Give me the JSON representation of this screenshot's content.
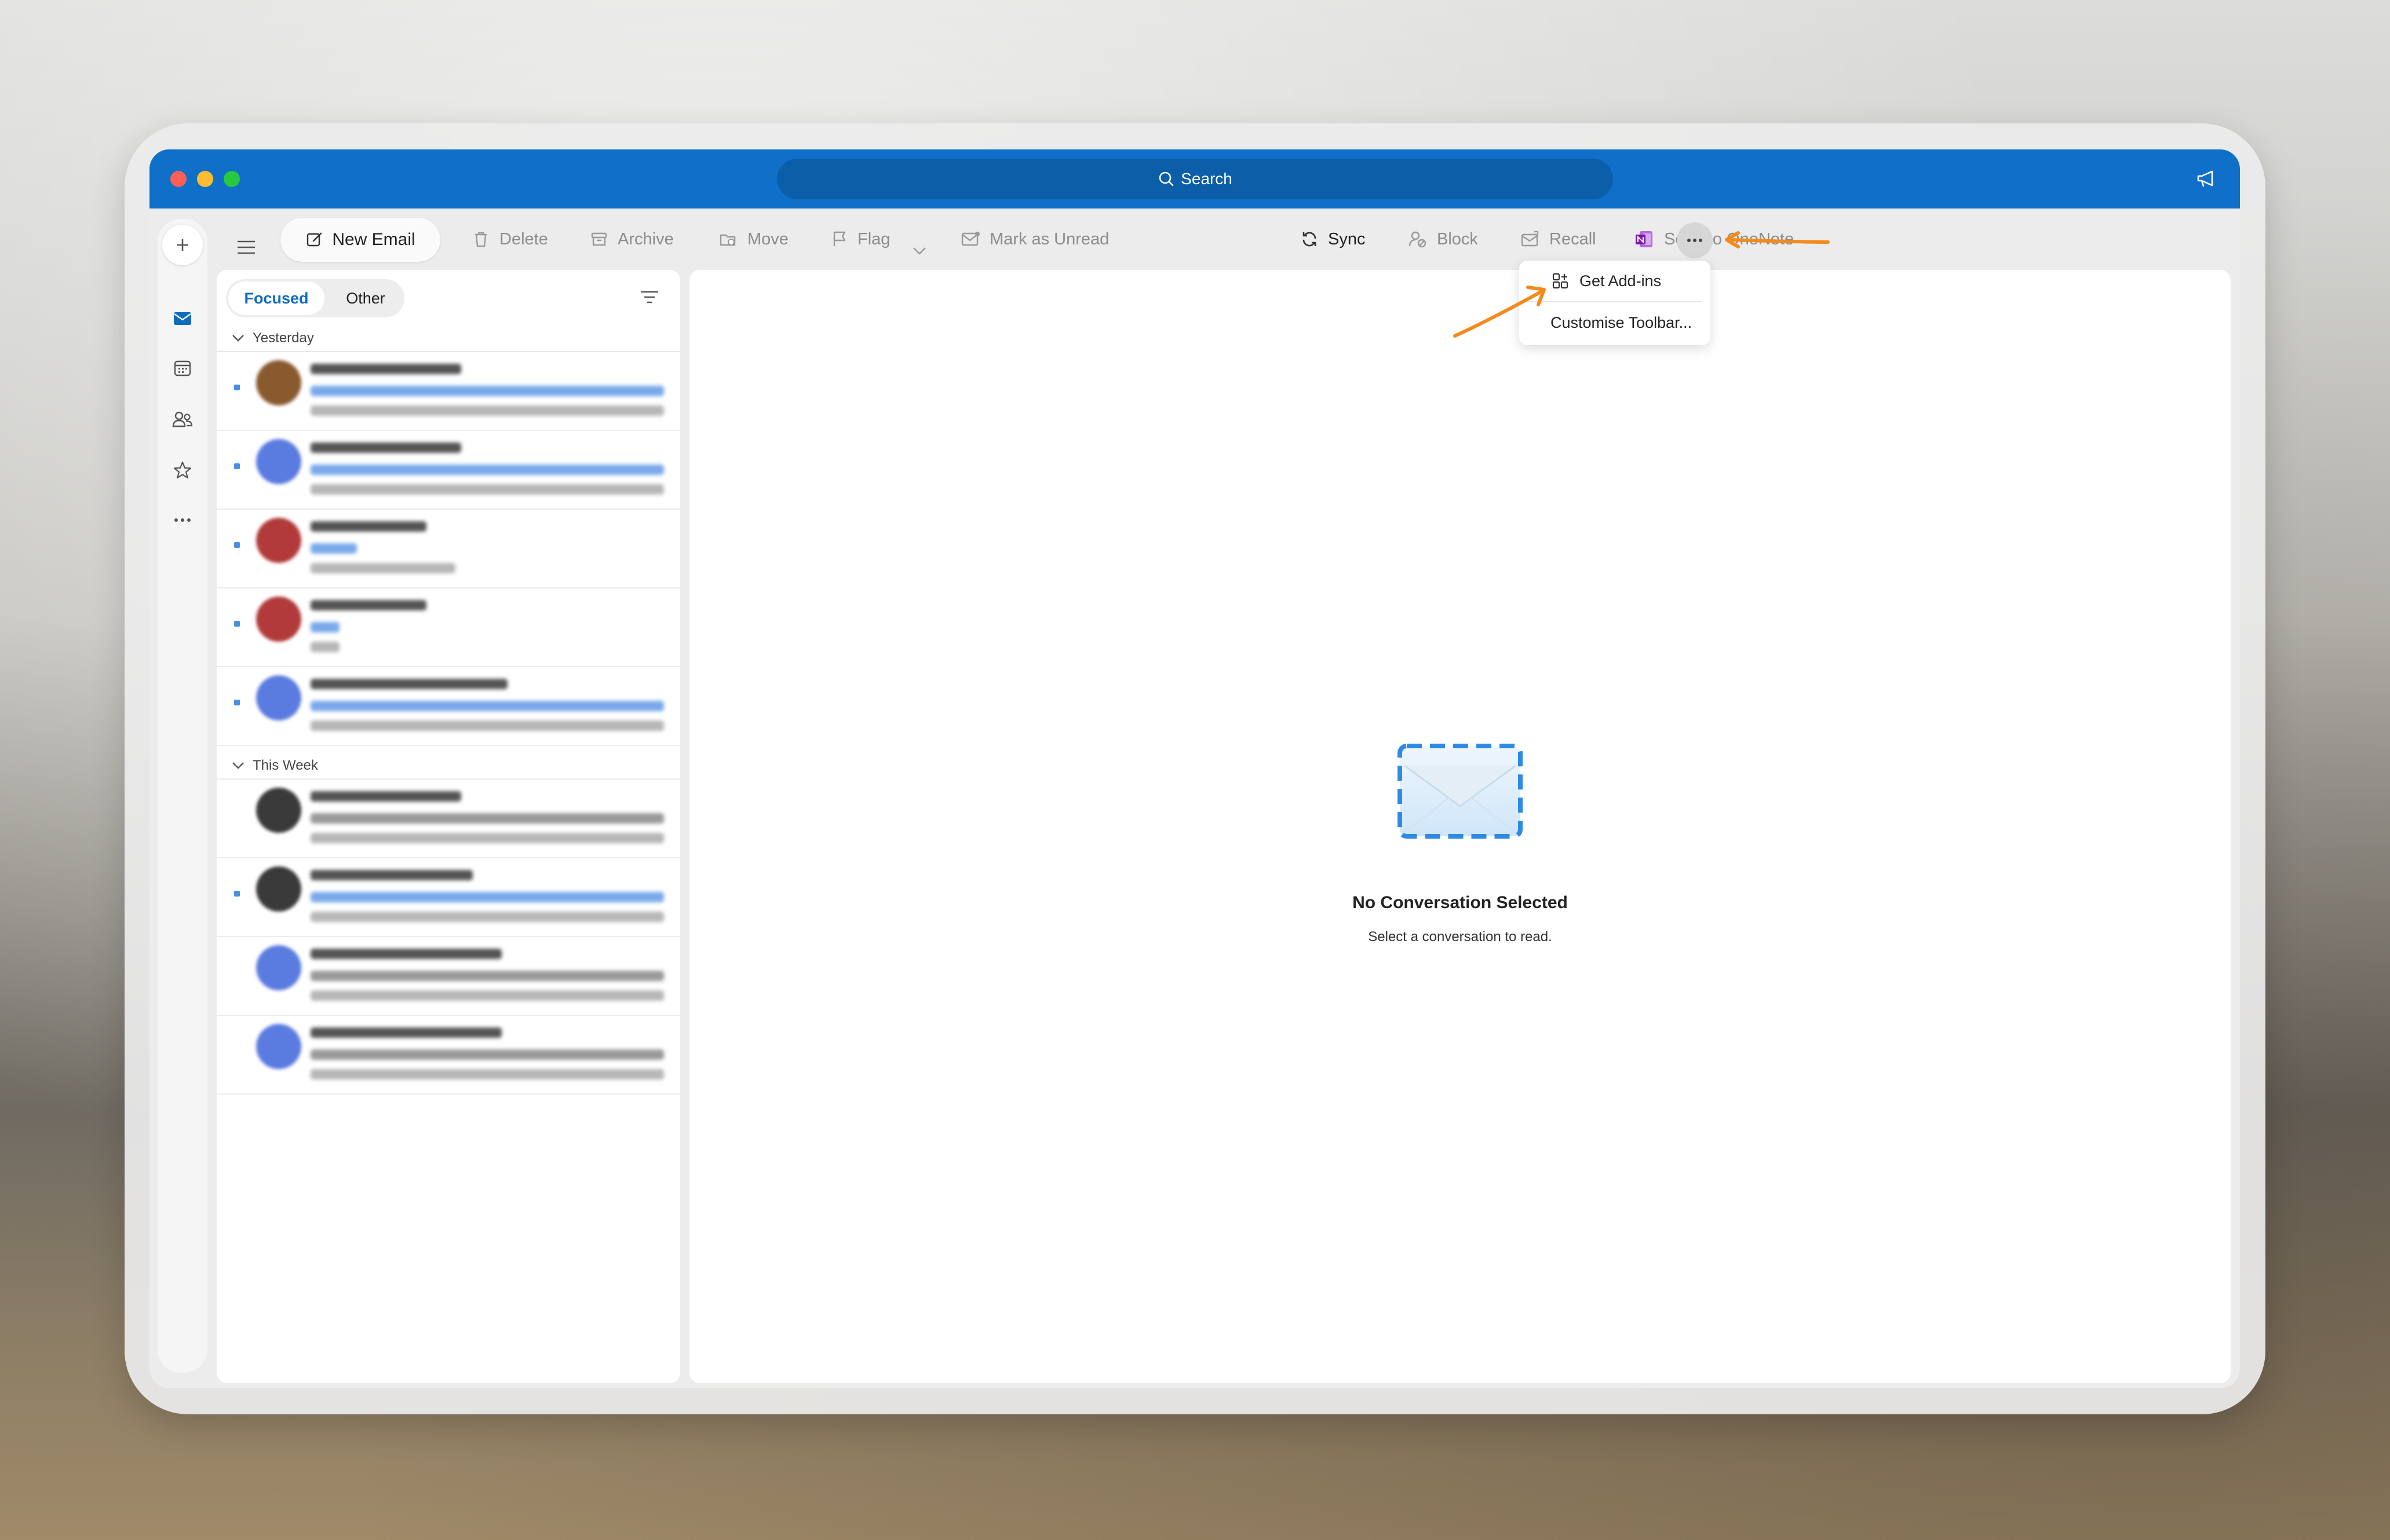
{
  "search": {
    "placeholder": "Search"
  },
  "toolbar": {
    "new_email": "New Email",
    "delete": "Delete",
    "archive": "Archive",
    "move": "Move",
    "flag": "Flag",
    "mark_unread": "Mark as Unread",
    "sync": "Sync",
    "block": "Block",
    "recall": "Recall",
    "send_onenote": "Send to OneNote"
  },
  "more_menu": {
    "items": [
      {
        "label": "Get Add-ins",
        "icon": "add-ins-icon"
      },
      {
        "label": "Customise Toolbar..."
      }
    ]
  },
  "list": {
    "tabs": {
      "focused": "Focused",
      "other": "Other"
    },
    "groups": [
      {
        "label": "Yesterday"
      },
      {
        "label": "This Week"
      }
    ]
  },
  "reading_pane": {
    "empty_title": "No Conversation Selected",
    "empty_subtitle": "Select a conversation to read."
  },
  "colors": {
    "titlebar": "#0f6fc9",
    "accent": "#0f6cbd",
    "annotation_arrow": "#f28a1c"
  },
  "icons": [
    "compose-icon",
    "trash-icon",
    "archive-icon",
    "move-icon",
    "flag-icon",
    "envelope-icon",
    "sync-icon",
    "block-icon",
    "recall-icon",
    "onenote-icon",
    "more-icon",
    "mail-icon",
    "calendar-icon",
    "people-icon",
    "star-icon"
  ]
}
